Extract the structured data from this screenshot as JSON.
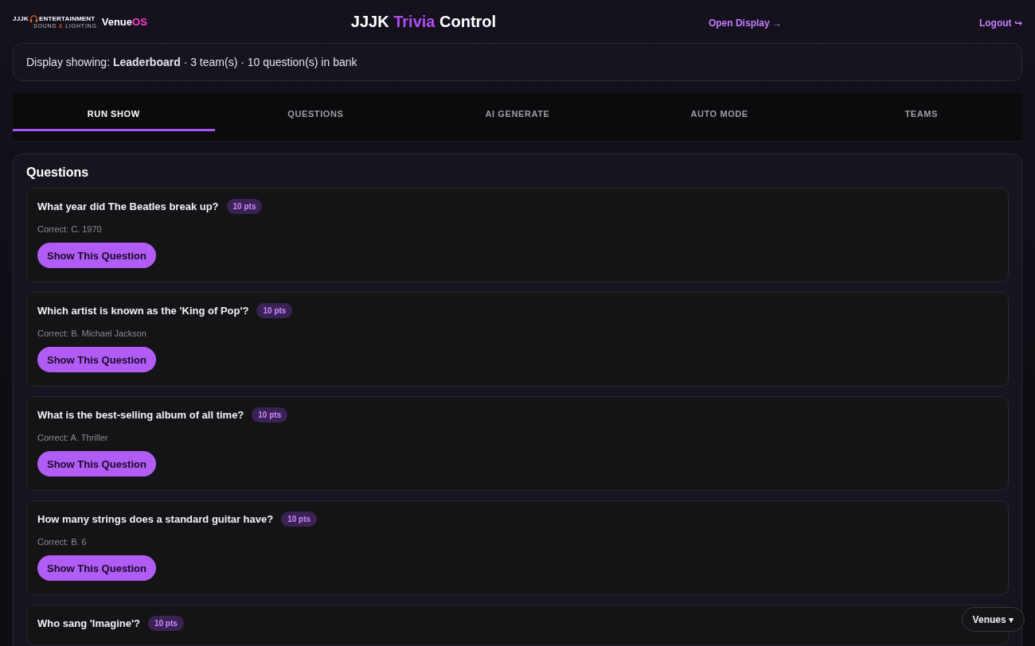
{
  "header": {
    "logo": {
      "brand": "JJJK",
      "word": "ENTERTAINMENT",
      "tagline_left": "SOUND",
      "tagline_amp": "&",
      "tagline_right": "LIGHTING"
    },
    "product": {
      "first": "Venue",
      "second": "OS"
    },
    "title": {
      "first": "JJJK",
      "accent": "Trivia",
      "last": "Control"
    },
    "open_display": "Open Display →",
    "logout": "Logout ↪"
  },
  "status": "Display showing: **Leaderboard** · 3 team(s) · 10 question(s) in bank",
  "tabs": [
    {
      "label": "RUN SHOW",
      "selected": true
    },
    {
      "label": "QUESTIONS",
      "selected": false
    },
    {
      "label": "AI GENERATE",
      "selected": false
    },
    {
      "label": "AUTO MODE",
      "selected": false
    },
    {
      "label": "TEAMS",
      "selected": false
    }
  ],
  "questions_panel": {
    "title": "Questions",
    "questions": [
      {
        "text": "What year did The Beatles break up?",
        "points": "10 pts",
        "correct": "Correct: C. 1970",
        "button": "Show This Question"
      },
      {
        "text": "Which artist is known as the 'King of Pop'?",
        "points": "10 pts",
        "correct": "Correct: B. Michael Jackson",
        "button": "Show This Question"
      },
      {
        "text": "What is the best-selling album of all time?",
        "points": "10 pts",
        "correct": "Correct: A. Thriller",
        "button": "Show This Question"
      },
      {
        "text": "How many strings does a standard guitar have?",
        "points": "10 pts",
        "correct": "Correct: B. 6",
        "button": "Show This Question"
      },
      {
        "text": "Who sang 'Imagine'?",
        "points": "10 pts"
      }
    ]
  },
  "venues_button": "Venues ▾"
}
